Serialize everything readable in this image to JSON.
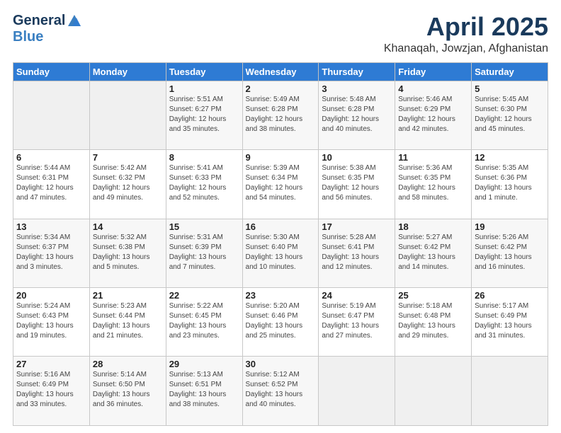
{
  "logo": {
    "general": "General",
    "blue": "Blue"
  },
  "header": {
    "title": "April 2025",
    "subtitle": "Khanaqah, Jowzjan, Afghanistan"
  },
  "days_of_week": [
    "Sunday",
    "Monday",
    "Tuesday",
    "Wednesday",
    "Thursday",
    "Friday",
    "Saturday"
  ],
  "weeks": [
    [
      {
        "day": "",
        "sunrise": "",
        "sunset": "",
        "daylight": "",
        "empty": true
      },
      {
        "day": "",
        "sunrise": "",
        "sunset": "",
        "daylight": "",
        "empty": true
      },
      {
        "day": "1",
        "sunrise": "Sunrise: 5:51 AM",
        "sunset": "Sunset: 6:27 PM",
        "daylight": "Daylight: 12 hours and 35 minutes."
      },
      {
        "day": "2",
        "sunrise": "Sunrise: 5:49 AM",
        "sunset": "Sunset: 6:28 PM",
        "daylight": "Daylight: 12 hours and 38 minutes."
      },
      {
        "day": "3",
        "sunrise": "Sunrise: 5:48 AM",
        "sunset": "Sunset: 6:28 PM",
        "daylight": "Daylight: 12 hours and 40 minutes."
      },
      {
        "day": "4",
        "sunrise": "Sunrise: 5:46 AM",
        "sunset": "Sunset: 6:29 PM",
        "daylight": "Daylight: 12 hours and 42 minutes."
      },
      {
        "day": "5",
        "sunrise": "Sunrise: 5:45 AM",
        "sunset": "Sunset: 6:30 PM",
        "daylight": "Daylight: 12 hours and 45 minutes."
      }
    ],
    [
      {
        "day": "6",
        "sunrise": "Sunrise: 5:44 AM",
        "sunset": "Sunset: 6:31 PM",
        "daylight": "Daylight: 12 hours and 47 minutes."
      },
      {
        "day": "7",
        "sunrise": "Sunrise: 5:42 AM",
        "sunset": "Sunset: 6:32 PM",
        "daylight": "Daylight: 12 hours and 49 minutes."
      },
      {
        "day": "8",
        "sunrise": "Sunrise: 5:41 AM",
        "sunset": "Sunset: 6:33 PM",
        "daylight": "Daylight: 12 hours and 52 minutes."
      },
      {
        "day": "9",
        "sunrise": "Sunrise: 5:39 AM",
        "sunset": "Sunset: 6:34 PM",
        "daylight": "Daylight: 12 hours and 54 minutes."
      },
      {
        "day": "10",
        "sunrise": "Sunrise: 5:38 AM",
        "sunset": "Sunset: 6:35 PM",
        "daylight": "Daylight: 12 hours and 56 minutes."
      },
      {
        "day": "11",
        "sunrise": "Sunrise: 5:36 AM",
        "sunset": "Sunset: 6:35 PM",
        "daylight": "Daylight: 12 hours and 58 minutes."
      },
      {
        "day": "12",
        "sunrise": "Sunrise: 5:35 AM",
        "sunset": "Sunset: 6:36 PM",
        "daylight": "Daylight: 13 hours and 1 minute."
      }
    ],
    [
      {
        "day": "13",
        "sunrise": "Sunrise: 5:34 AM",
        "sunset": "Sunset: 6:37 PM",
        "daylight": "Daylight: 13 hours and 3 minutes."
      },
      {
        "day": "14",
        "sunrise": "Sunrise: 5:32 AM",
        "sunset": "Sunset: 6:38 PM",
        "daylight": "Daylight: 13 hours and 5 minutes."
      },
      {
        "day": "15",
        "sunrise": "Sunrise: 5:31 AM",
        "sunset": "Sunset: 6:39 PM",
        "daylight": "Daylight: 13 hours and 7 minutes."
      },
      {
        "day": "16",
        "sunrise": "Sunrise: 5:30 AM",
        "sunset": "Sunset: 6:40 PM",
        "daylight": "Daylight: 13 hours and 10 minutes."
      },
      {
        "day": "17",
        "sunrise": "Sunrise: 5:28 AM",
        "sunset": "Sunset: 6:41 PM",
        "daylight": "Daylight: 13 hours and 12 minutes."
      },
      {
        "day": "18",
        "sunrise": "Sunrise: 5:27 AM",
        "sunset": "Sunset: 6:42 PM",
        "daylight": "Daylight: 13 hours and 14 minutes."
      },
      {
        "day": "19",
        "sunrise": "Sunrise: 5:26 AM",
        "sunset": "Sunset: 6:42 PM",
        "daylight": "Daylight: 13 hours and 16 minutes."
      }
    ],
    [
      {
        "day": "20",
        "sunrise": "Sunrise: 5:24 AM",
        "sunset": "Sunset: 6:43 PM",
        "daylight": "Daylight: 13 hours and 19 minutes."
      },
      {
        "day": "21",
        "sunrise": "Sunrise: 5:23 AM",
        "sunset": "Sunset: 6:44 PM",
        "daylight": "Daylight: 13 hours and 21 minutes."
      },
      {
        "day": "22",
        "sunrise": "Sunrise: 5:22 AM",
        "sunset": "Sunset: 6:45 PM",
        "daylight": "Daylight: 13 hours and 23 minutes."
      },
      {
        "day": "23",
        "sunrise": "Sunrise: 5:20 AM",
        "sunset": "Sunset: 6:46 PM",
        "daylight": "Daylight: 13 hours and 25 minutes."
      },
      {
        "day": "24",
        "sunrise": "Sunrise: 5:19 AM",
        "sunset": "Sunset: 6:47 PM",
        "daylight": "Daylight: 13 hours and 27 minutes."
      },
      {
        "day": "25",
        "sunrise": "Sunrise: 5:18 AM",
        "sunset": "Sunset: 6:48 PM",
        "daylight": "Daylight: 13 hours and 29 minutes."
      },
      {
        "day": "26",
        "sunrise": "Sunrise: 5:17 AM",
        "sunset": "Sunset: 6:49 PM",
        "daylight": "Daylight: 13 hours and 31 minutes."
      }
    ],
    [
      {
        "day": "27",
        "sunrise": "Sunrise: 5:16 AM",
        "sunset": "Sunset: 6:49 PM",
        "daylight": "Daylight: 13 hours and 33 minutes."
      },
      {
        "day": "28",
        "sunrise": "Sunrise: 5:14 AM",
        "sunset": "Sunset: 6:50 PM",
        "daylight": "Daylight: 13 hours and 36 minutes."
      },
      {
        "day": "29",
        "sunrise": "Sunrise: 5:13 AM",
        "sunset": "Sunset: 6:51 PM",
        "daylight": "Daylight: 13 hours and 38 minutes."
      },
      {
        "day": "30",
        "sunrise": "Sunrise: 5:12 AM",
        "sunset": "Sunset: 6:52 PM",
        "daylight": "Daylight: 13 hours and 40 minutes."
      },
      {
        "day": "",
        "sunrise": "",
        "sunset": "",
        "daylight": "",
        "empty": true
      },
      {
        "day": "",
        "sunrise": "",
        "sunset": "",
        "daylight": "",
        "empty": true
      },
      {
        "day": "",
        "sunrise": "",
        "sunset": "",
        "daylight": "",
        "empty": true
      }
    ]
  ]
}
